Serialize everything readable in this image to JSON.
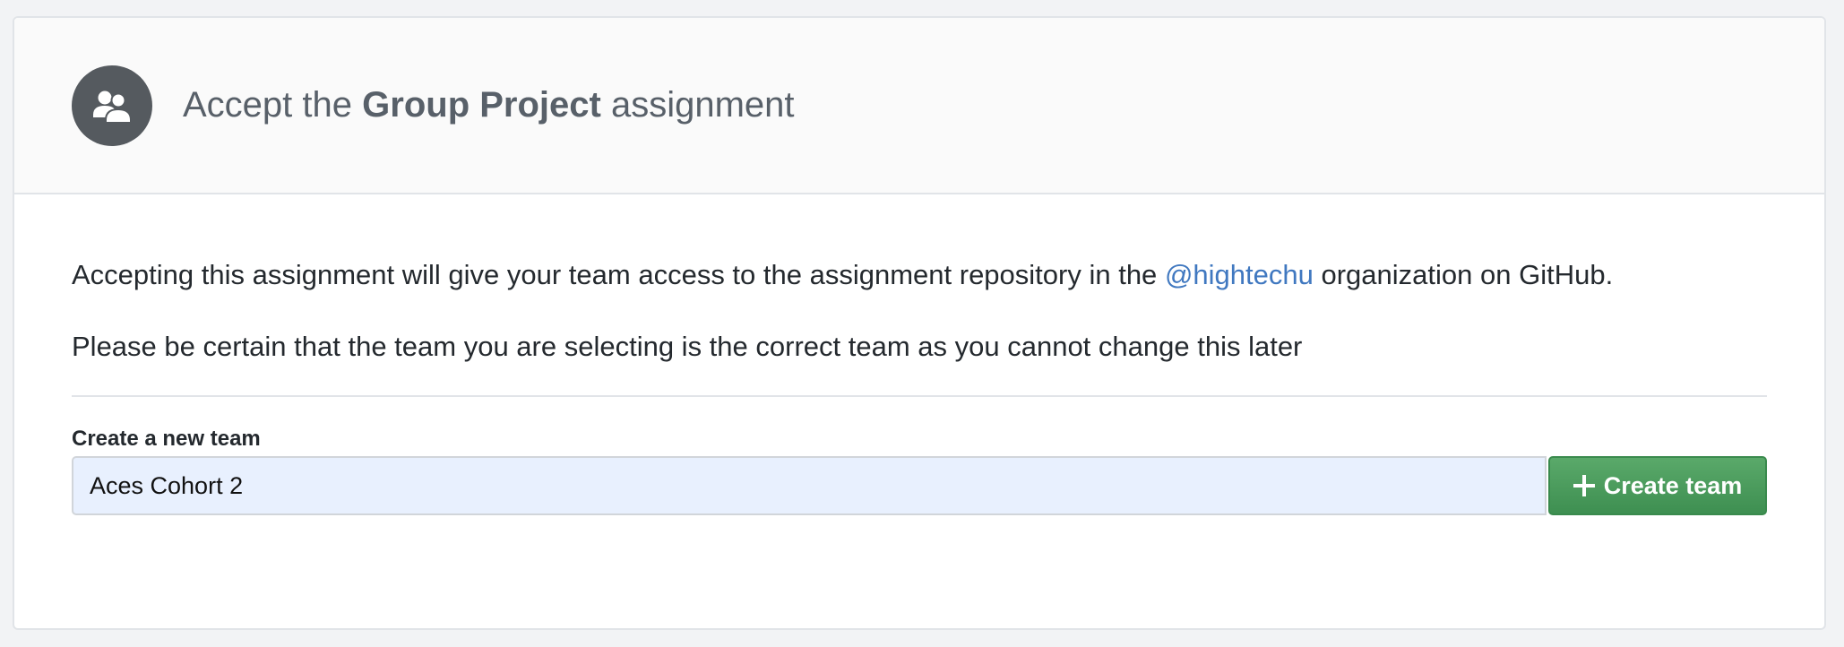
{
  "header": {
    "title_prefix": "Accept the",
    "assignment_name": "Group Project",
    "title_suffix": "assignment",
    "avatar_icon": "people-icon"
  },
  "body": {
    "intro_before": "Accepting this assignment will give your team access to the assignment repository in the",
    "organization_link": "@hightechu",
    "intro_after": "organization on GitHub.",
    "warning": "Please be certain that the team you are selecting is the correct team as you cannot change this later"
  },
  "team_form": {
    "label": "Create a new team",
    "input_value": "Aces Cohort 2",
    "button_label": "Create team",
    "button_icon": "plus-icon"
  },
  "colors": {
    "link": "#4078c0",
    "button_green": "#4a9b5d",
    "avatar_bg": "#555a5f",
    "input_bg": "#e8f0fe"
  }
}
